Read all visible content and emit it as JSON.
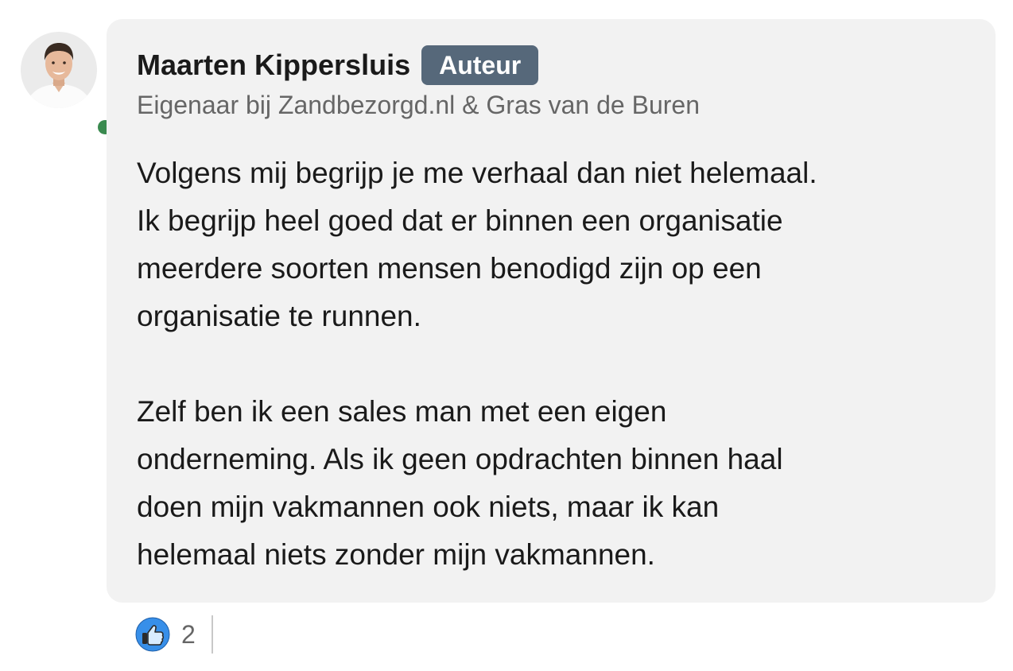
{
  "comment": {
    "author": {
      "name": "Maarten Kippersluis",
      "badge": "Auteur",
      "headline": "Eigenaar bij Zandbezorgd.nl & Gras van de Buren",
      "avatar_icon": "profile-photo",
      "presence": "online",
      "presence_color": "#3a8a4f"
    },
    "body": {
      "paragraph_1": "Volgens mij begrijp je me verhaal dan niet helemaal.\nIk begrijp heel goed dat er binnen een organisatie\nmeerdere soorten mensen benodigd zijn op een\norganisatie te runnen.",
      "paragraph_2": "Zelf ben ik een sales man met een eigen\nonderneming. Als ik geen opdrachten binnen haal\ndoen mijn vakmannen ook niets, maar ik kan\nhelemaal niets zonder mijn vakmannen."
    },
    "reactions": {
      "icon": "like-icon",
      "count": "2"
    },
    "colors": {
      "bubble_background": "#f2f2f2",
      "badge_background": "#56687a",
      "like_blue": "#378fe9"
    }
  }
}
